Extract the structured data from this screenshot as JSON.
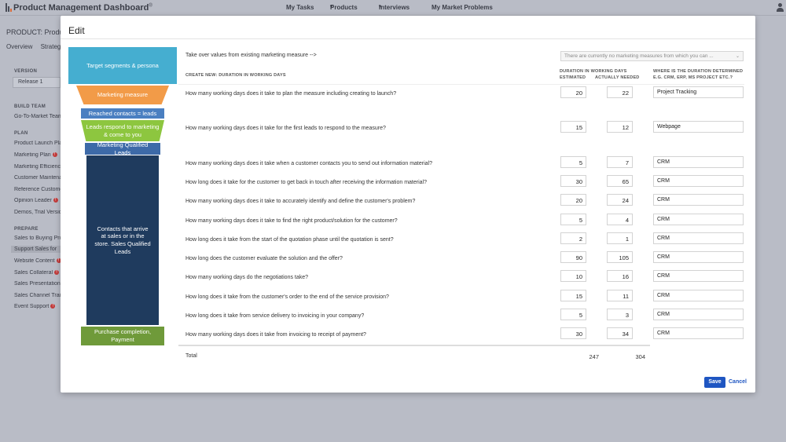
{
  "app": {
    "title": "Product Management Dashboard",
    "trademark": "®"
  },
  "top_nav": {
    "items": [
      {
        "label": "My Tasks"
      },
      {
        "label": "Products"
      },
      {
        "label": "Interviews"
      },
      {
        "label": "My Market Problems"
      }
    ]
  },
  "background": {
    "product": "PRODUCT: Product",
    "tabs": [
      "Overview",
      "Strategic"
    ]
  },
  "sidebar": {
    "version_head": "VERSION",
    "version_value": "Release 1",
    "build_head": "BUILD TEAM",
    "build_item": "Go-To-Market Team",
    "plan_head": "PLAN",
    "plan_items": [
      "Product Launch Plan",
      "Marketing Plan",
      "Marketing Efficiency",
      "Customer Maintenance",
      "Reference Customers",
      "Opinion Leader",
      "Demos, Trial Versions"
    ],
    "prepare_head": "PREPARE",
    "prepare_items": [
      "Sales to Buying Process",
      "Support Sales for",
      "Website Content",
      "Sales Collateral",
      "Sales Presentation",
      "Sales Channel Training",
      "Event Support"
    ],
    "warn_glyph": "!"
  },
  "modal": {
    "title": "Edit",
    "takeover_label": "Take over values from existing marketing measure -->",
    "takeover_placeholder": "There are currently no marketing measures from which you can ...",
    "create_new_label": "CREATE NEW: DURATION IN WORKING DAYS",
    "col_duration_1": "DURATION IN WORKING DAYS",
    "col_estimated": "ESTIMATED",
    "col_actual": "ACTUALLY NEEDED",
    "col_where_1": "WHERE IS THE DURATION DETERMINED",
    "col_where_2": "E.G. CRM, ERP, MS PROJECT ETC.?",
    "total_label": "Total",
    "total_estimated": "247",
    "total_actual": "304",
    "save_label": "Save",
    "cancel_label": "Cancel"
  },
  "funnel": [
    {
      "label": "Target segments & persona",
      "color": "#45aed0"
    },
    {
      "label": "Marketing measure",
      "color": "#f29b48"
    },
    {
      "label": "Reached contacts = leads",
      "color": "#4a7fc1"
    },
    {
      "label": "Leads respond to marketing & come to you",
      "color": "#8dc63f"
    },
    {
      "label": "Marketing Qualified Leads",
      "color": "#3d6aa8"
    },
    {
      "label": "Contacts that arrive at sales or in the store. Sales Qualified Leads",
      "color": "#1f3b5e"
    },
    {
      "label": "Purchase completion, Payment",
      "color": "#6f9a3a"
    }
  ],
  "rows": [
    {
      "question": "How many working days does it take to plan the measure including creating to launch?",
      "estimated": "20",
      "actual": "22",
      "system": "Project Tracking"
    },
    {
      "question": "How many working days does it take for the first leads to respond to the measure?",
      "estimated": "15",
      "actual": "12",
      "system": "Webpage"
    },
    {
      "question": "How many working days does it take when a customer contacts you to send out information material?",
      "estimated": "5",
      "actual": "7",
      "system": "CRM"
    },
    {
      "question": "How long does it take for the customer to get back in touch after receiving the information material?",
      "estimated": "30",
      "actual": "65",
      "system": "CRM"
    },
    {
      "question": "How many working days does it take to accurately identify and define the customer's problem?",
      "estimated": "20",
      "actual": "24",
      "system": "CRM"
    },
    {
      "question": "How many working days does it take to find the right product/solution for the customer?",
      "estimated": "5",
      "actual": "4",
      "system": "CRM"
    },
    {
      "question": "How long does it take from the start of the quotation phase until the quotation is sent?",
      "estimated": "2",
      "actual": "1",
      "system": "CRM"
    },
    {
      "question": "How long does the customer evaluate the solution and the offer?",
      "estimated": "90",
      "actual": "105",
      "system": "CRM"
    },
    {
      "question": "How many working days do the negotiations take?",
      "estimated": "10",
      "actual": "16",
      "system": "CRM"
    },
    {
      "question": "How long does it take from the customer's order to the end of the service provision?",
      "estimated": "15",
      "actual": "11",
      "system": "CRM"
    },
    {
      "question": "How long does it take from service delivery to invoicing in your company?",
      "estimated": "5",
      "actual": "3",
      "system": "CRM"
    },
    {
      "question": "How many working days does it take from invoicing to receipt of payment?",
      "estimated": "30",
      "actual": "34",
      "system": "CRM"
    }
  ]
}
